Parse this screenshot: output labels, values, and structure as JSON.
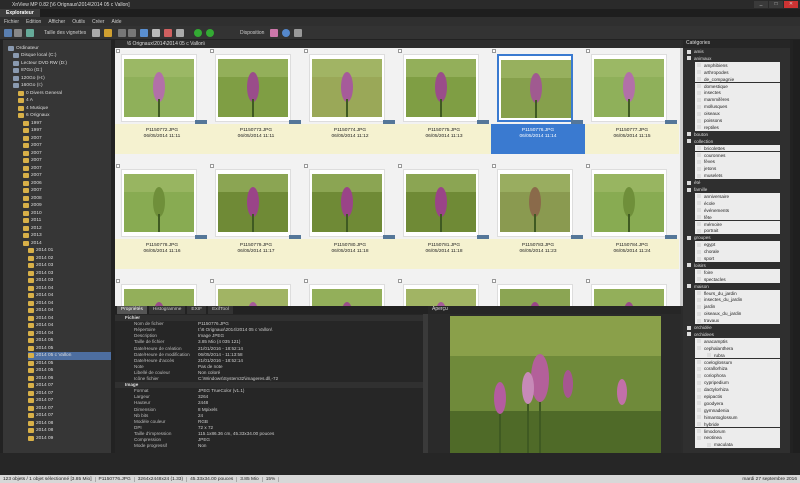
{
  "window": {
    "title": "XnView MP 0.82  [\\6 Orignaux\\2014\\2014 05 c Vallon]"
  },
  "tabs": [
    {
      "label": "Explorateur"
    }
  ],
  "menu": [
    "Fichier",
    "Edition",
    "Afficher",
    "Outils",
    "Créer",
    "Aide"
  ],
  "toolbar": {
    "thumb_size_label": "Taille des vignettes",
    "layout_label": "Disposition"
  },
  "path": "\\6 Orignaux\\2014\\2014 05 c Vallon\\",
  "tree": [
    {
      "label": "Ordinateur",
      "indent": 1
    },
    {
      "label": "Disque local (C:)",
      "indent": 2
    },
    {
      "label": "Lecteur DVD RW (D:)",
      "indent": 2
    },
    {
      "label": "87Go (G:)",
      "indent": 2
    },
    {
      "label": "120Go (H:)",
      "indent": 2
    },
    {
      "label": "160Go (I:)",
      "indent": 2
    },
    {
      "label": "0 Divers General",
      "indent": 3
    },
    {
      "label": "4 A",
      "indent": 3
    },
    {
      "label": "4 Musique",
      "indent": 3
    },
    {
      "label": "6 Orignaux",
      "indent": 3
    },
    {
      "label": "1997",
      "indent": 4
    },
    {
      "label": "1997",
      "indent": 4
    },
    {
      "label": "2007",
      "indent": 4
    },
    {
      "label": "2007",
      "indent": 4
    },
    {
      "label": "2007",
      "indent": 4
    },
    {
      "label": "2007",
      "indent": 4
    },
    {
      "label": "2007",
      "indent": 4
    },
    {
      "label": "2007",
      "indent": 4
    },
    {
      "label": "2006",
      "indent": 4
    },
    {
      "label": "2007",
      "indent": 4
    },
    {
      "label": "2008",
      "indent": 4
    },
    {
      "label": "2009",
      "indent": 4
    },
    {
      "label": "2010",
      "indent": 4
    },
    {
      "label": "2011",
      "indent": 4
    },
    {
      "label": "2012",
      "indent": 4
    },
    {
      "label": "2013",
      "indent": 4
    },
    {
      "label": "2014",
      "indent": 4
    },
    {
      "label": "2014 01",
      "indent": 5
    },
    {
      "label": "2014 02",
      "indent": 5
    },
    {
      "label": "2014 03",
      "indent": 5
    },
    {
      "label": "2014 03",
      "indent": 5
    },
    {
      "label": "2014 03",
      "indent": 5
    },
    {
      "label": "2014 04",
      "indent": 5
    },
    {
      "label": "2014 04",
      "indent": 5
    },
    {
      "label": "2014 04",
      "indent": 5
    },
    {
      "label": "2014 04",
      "indent": 5
    },
    {
      "label": "2014 04",
      "indent": 5
    },
    {
      "label": "2014 04",
      "indent": 5
    },
    {
      "label": "2014 04",
      "indent": 5
    },
    {
      "label": "2014 05",
      "indent": 5
    },
    {
      "label": "2014 05",
      "indent": 5
    },
    {
      "label": "2014 05 c Vallon",
      "indent": 5,
      "selected": true
    },
    {
      "label": "2014 05",
      "indent": 5
    },
    {
      "label": "2014 05",
      "indent": 5
    },
    {
      "label": "2014 06",
      "indent": 5
    },
    {
      "label": "2014 07",
      "indent": 5
    },
    {
      "label": "2014 07",
      "indent": 5
    },
    {
      "label": "2014 07",
      "indent": 5
    },
    {
      "label": "2014 07",
      "indent": 5
    },
    {
      "label": "2014 07",
      "indent": 5
    },
    {
      "label": "2014 08",
      "indent": 5
    },
    {
      "label": "2014 08",
      "indent": 5
    },
    {
      "label": "2014 09",
      "indent": 5
    }
  ],
  "thumbnails": [
    {
      "filename": "P1150772.JPG",
      "date": "06/05/2014 11:11",
      "tone": "a"
    },
    {
      "filename": "P1150773.JPG",
      "date": "06/05/2014 11:11",
      "tone": "b"
    },
    {
      "filename": "P1150774.JPG",
      "date": "06/05/2014 11:12",
      "tone": "c"
    },
    {
      "filename": "P1150775.JPG",
      "date": "06/05/2014 11:13",
      "tone": "b"
    },
    {
      "filename": "P1150776.JPG",
      "date": "06/05/2014 11:14",
      "tone": "d",
      "selected": true
    },
    {
      "filename": "P1150777.JPG",
      "date": "06/05/2014 11:15",
      "tone": "a"
    },
    {
      "filename": "P1150778.JPG",
      "date": "06/05/2014 11:16",
      "tone": "e"
    },
    {
      "filename": "P1150779.JPG",
      "date": "06/05/2014 11:17",
      "tone": "f"
    },
    {
      "filename": "P1150780.JPG",
      "date": "06/05/2014 11:18",
      "tone": "f"
    },
    {
      "filename": "P1150781.JPG",
      "date": "06/05/2014 11:18",
      "tone": "f"
    },
    {
      "filename": "P1150783.JPG",
      "date": "06/05/2014 11:23",
      "tone": "g"
    },
    {
      "filename": "P1150784.JPG",
      "date": "06/05/2014 11:24",
      "tone": "e"
    },
    {
      "filename": "",
      "date": "",
      "tone": "b"
    },
    {
      "filename": "",
      "date": "",
      "tone": "c"
    },
    {
      "filename": "",
      "date": "",
      "tone": "b"
    },
    {
      "filename": "",
      "date": "",
      "tone": "c"
    },
    {
      "filename": "",
      "date": "",
      "tone": "f"
    },
    {
      "filename": "",
      "date": "",
      "tone": "b"
    }
  ],
  "properties_tabs": [
    "Propriétés",
    "Histogramme",
    "EXIF",
    "ExifTool"
  ],
  "properties": [
    {
      "section": "Fichier"
    },
    {
      "key": "Nom de fichier",
      "value": "P1150776.JPG"
    },
    {
      "key": "Répertoire",
      "value": "I:\\6 Orignaux\\2014\\2014 05 c Vallon\\"
    },
    {
      "key": "Description",
      "value": "Image JPEG"
    },
    {
      "key": "Taille de fichier",
      "value": "3.85 Mio (4 035 121)"
    },
    {
      "key": "Date/Heure de création",
      "value": "21/01/2016 - 18:52:14"
    },
    {
      "key": "Date/Heure de modification",
      "value": "06/05/2014 - 11:13:58"
    },
    {
      "key": "Date/Heure d'accès",
      "value": "21/01/2016 - 18:52:14"
    },
    {
      "key": "Note",
      "value": "Pas de note"
    },
    {
      "key": "Libellé de couleur",
      "value": "Non coloré"
    },
    {
      "key": "Icône fichier",
      "value": "C:\\Windows\\System32\\imageres.dll,-72"
    },
    {
      "section": "Image"
    },
    {
      "key": "Format",
      "value": "JPEG TrueColor (v1.1)"
    },
    {
      "key": "Largeur",
      "value": "3264"
    },
    {
      "key": "Hauteur",
      "value": "2448"
    },
    {
      "key": "Dimension",
      "value": "8 Mpixels"
    },
    {
      "key": "Nb bits",
      "value": "24"
    },
    {
      "key": "Modèle couleur",
      "value": "RGB"
    },
    {
      "key": "DPI",
      "value": "72 x 72"
    },
    {
      "key": "Taille d'impression",
      "value": "115.1x86.36 cm, 45.33x34.00 pouces"
    },
    {
      "key": "Compression",
      "value": "JPEG"
    },
    {
      "key": "Mode progressif",
      "value": "Non"
    }
  ],
  "preview_title": "Aperçu",
  "categories_title": "Catégories",
  "categories": [
    {
      "label": "amis",
      "level": 0
    },
    {
      "label": "animaux",
      "level": 0
    },
    {
      "label": "amphibiens",
      "level": 1
    },
    {
      "label": "arthropodes",
      "level": 1
    },
    {
      "label": "de_compagnie",
      "level": 1
    },
    {
      "label": "domestique",
      "level": 1
    },
    {
      "label": "insectes",
      "level": 1
    },
    {
      "label": "mammifères",
      "level": 1
    },
    {
      "label": "mollusques",
      "level": 1
    },
    {
      "label": "oiseaux",
      "level": 1
    },
    {
      "label": "poissons",
      "level": 1
    },
    {
      "label": "reptiles",
      "level": 1
    },
    {
      "label": "bouton",
      "level": 0
    },
    {
      "label": "collection",
      "level": 0
    },
    {
      "label": "bricolettes",
      "level": 1
    },
    {
      "label": "couronnes",
      "level": 1
    },
    {
      "label": "fèves",
      "level": 1
    },
    {
      "label": "jetons",
      "level": 1
    },
    {
      "label": "muselets",
      "level": 1
    },
    {
      "label": "été",
      "level": 0
    },
    {
      "label": "famille",
      "level": 0
    },
    {
      "label": "anniversaire",
      "level": 1
    },
    {
      "label": "école",
      "level": 1
    },
    {
      "label": "événements",
      "level": 1
    },
    {
      "label": "fête",
      "level": 1
    },
    {
      "label": "mémoire",
      "level": 1
    },
    {
      "label": "portrait",
      "level": 1
    },
    {
      "label": "groupes",
      "level": 0
    },
    {
      "label": "egypt",
      "level": 1
    },
    {
      "label": "chorale",
      "level": 1
    },
    {
      "label": "sport",
      "level": 1
    },
    {
      "label": "loisirs",
      "level": 0
    },
    {
      "label": "foire",
      "level": 1
    },
    {
      "label": "spectacles",
      "level": 1
    },
    {
      "label": "maison",
      "level": 0
    },
    {
      "label": "fleurs_du_jardin",
      "level": 1
    },
    {
      "label": "insectes_du_jardin",
      "level": 1
    },
    {
      "label": "jardin",
      "level": 1
    },
    {
      "label": "oiseaux_du_jardin",
      "level": 1
    },
    {
      "label": "travaux",
      "level": 1
    },
    {
      "label": "orchidée",
      "level": 0
    },
    {
      "label": "orchidees",
      "level": 0
    },
    {
      "label": "anacamptis",
      "level": 1
    },
    {
      "label": "cephalanthera",
      "level": 1
    },
    {
      "label": "rubra",
      "level": 2
    },
    {
      "label": "coeloglossum",
      "level": 1
    },
    {
      "label": "corallorhiza",
      "level": 1
    },
    {
      "label": "coriophora",
      "level": 1
    },
    {
      "label": "cypripedium",
      "level": 1
    },
    {
      "label": "dactylorhiza",
      "level": 1
    },
    {
      "label": "epipactis",
      "level": 1
    },
    {
      "label": "goodyera",
      "level": 1
    },
    {
      "label": "gymnadenia",
      "level": 1
    },
    {
      "label": "himantoglossum",
      "level": 1
    },
    {
      "label": "hybride",
      "level": 1
    },
    {
      "label": "limodorum",
      "level": 1
    },
    {
      "label": "neotinea",
      "level": 1
    },
    {
      "label": "maculata",
      "level": 2
    }
  ],
  "status": {
    "count": "123 objets / 1 objet sélectionné [3.85 Mio]",
    "file": "P1150776.JPG",
    "dims": "3264x2448x24 (1.33)",
    "print": "45.33x34.00 pouces",
    "size": "3.85 Mio",
    "zoom": "15%",
    "clock": "mardi 27 septembre 2016"
  },
  "colors": {
    "accent": "#3a7ad0",
    "meta_bg": "#f5f2d0"
  }
}
